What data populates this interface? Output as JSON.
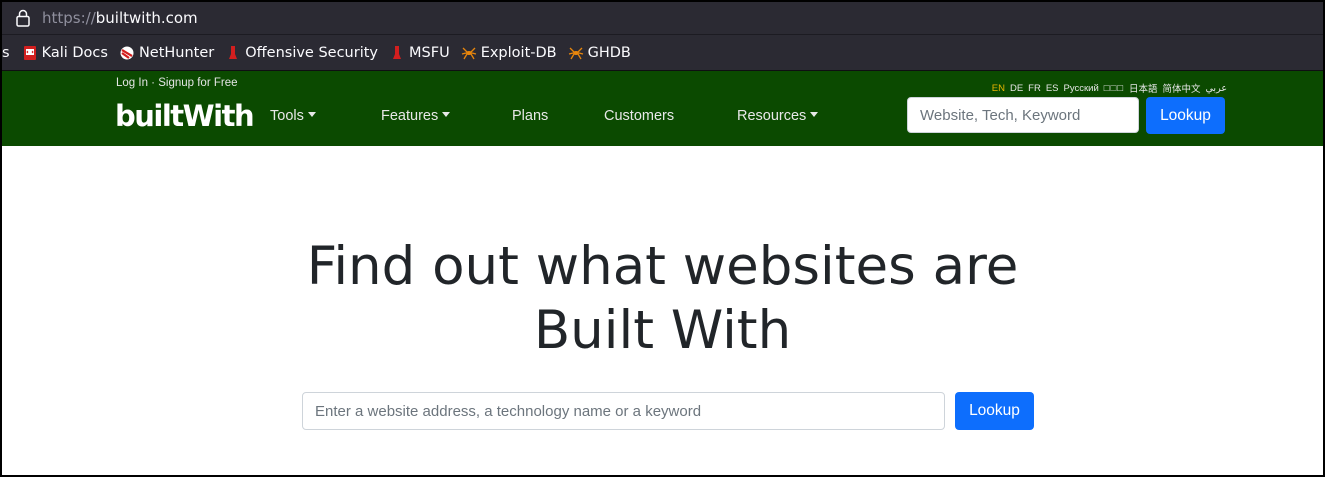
{
  "browser": {
    "url_scheme": "https://",
    "url_host": "builtwith.com",
    "bookmarks": [
      {
        "label": "s",
        "icon": "truncated"
      },
      {
        "label": "Kali Docs",
        "icon": "kali-docs-icon"
      },
      {
        "label": "NetHunter",
        "icon": "nethunter-icon"
      },
      {
        "label": "Offensive Security",
        "icon": "offsec-icon"
      },
      {
        "label": "MSFU",
        "icon": "msfu-icon"
      },
      {
        "label": "Exploit-DB",
        "icon": "exploitdb-icon"
      },
      {
        "label": "GHDB",
        "icon": "ghdb-icon"
      }
    ]
  },
  "nav": {
    "login": "Log In",
    "separator": " · ",
    "signup": "Signup for Free",
    "logo": "builtWith",
    "menu": {
      "tools": "Tools",
      "features": "Features",
      "plans": "Plans",
      "customers": "Customers",
      "resources": "Resources"
    },
    "languages": {
      "en": "EN",
      "de": "DE",
      "fr": "FR",
      "es": "ES",
      "ru": "Русский",
      "boxes": "□□□",
      "ja": "日本語",
      "zh": "简体中文",
      "ar": "عربي"
    },
    "search_placeholder": "Website, Tech, Keyword",
    "lookup_label": "Lookup"
  },
  "hero": {
    "title_line1": "Find out what websites are",
    "title_line2": "Built With",
    "search_placeholder": "Enter a website address, a technology name or a keyword",
    "lookup_label": "Lookup"
  },
  "colors": {
    "navbar": "#0b4a00",
    "button": "#0d6efd",
    "browser_chrome": "#2b2a33",
    "active_language": "#e8b400"
  }
}
